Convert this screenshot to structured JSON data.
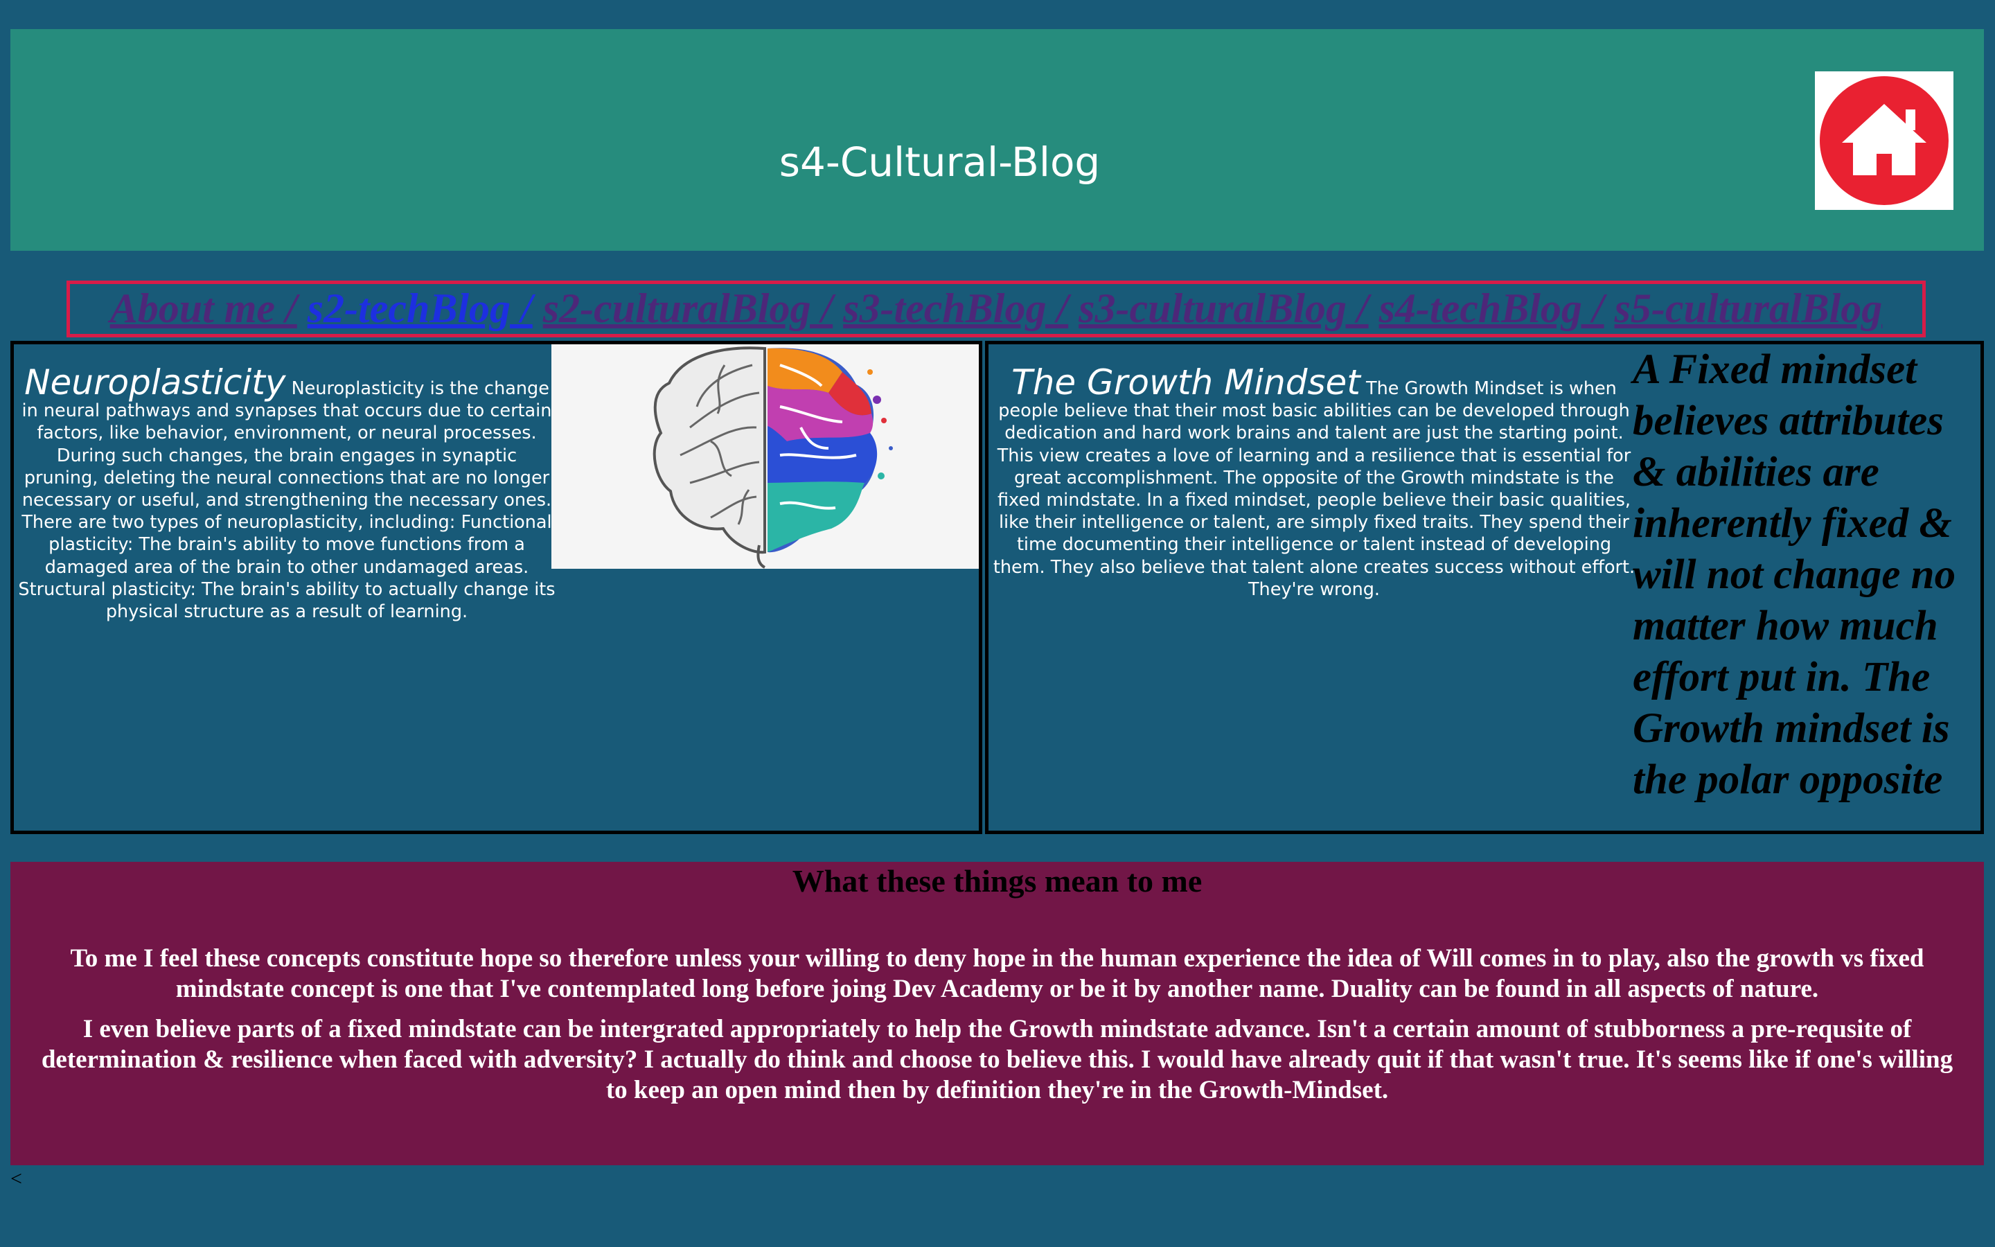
{
  "header": {
    "title": "s4-Cultural-Blog",
    "home_icon": "home-icon",
    "home_icon_color": "#e92131"
  },
  "nav": {
    "items": [
      {
        "label": "About me /"
      },
      {
        "label": "s2-techBlog /"
      },
      {
        "label": "s2-culturalBlog /"
      },
      {
        "label": "s3-techBlog /"
      },
      {
        "label": "s3-culturalBlog /"
      },
      {
        "label": "s4-techBlog /"
      },
      {
        "label": "s5-culturalBlog"
      }
    ],
    "active_color": "#1d2fe0",
    "link_color": "#4d2779",
    "border_color": "#d81c48"
  },
  "neuroplasticity": {
    "title": "Neuroplasticity",
    "body": "Neuroplasticity is the change in neural pathways and synapses that occurs due to certain factors, like behavior, environment, or neural processes. During such changes, the brain engages in synaptic pruning, deleting the neural connections that are no longer necessary or useful, and strengthening the necessary ones. There are two types of neuroplasticity, including: Functional plasticity: The brain's ability to move functions from a damaged area of the brain to other undamaged areas. Structural plasticity: The brain's ability to actually change its physical structure as a result of learning.",
    "image": "brain-illustration"
  },
  "growth_mindset": {
    "title": "The Growth Mindset",
    "body": "The Growth Mindset is when people believe that their most basic abilities can be developed through dedication and hard work brains and talent are just the starting point. This view creates a love of learning and a resilience that is essential for great accomplishment. The opposite of the Growth mindstate is the fixed mindstate. In a fixed mindset, people believe their basic qualities, like their intelligence or talent, are simply fixed traits. They spend their time documenting their intelligence or talent instead of developing them. They also believe that talent alone creates success without effort. They're wrong.",
    "quote": "A Fixed mindset believes attributes & abilities are inherently fixed & will not change no matter how much effort put in. The Growth mindset is the polar opposite"
  },
  "meaning": {
    "title": "What these things mean to me",
    "paragraph1": "To me I feel these concepts constitute hope so therefore unless your willing to deny hope in the human experience the idea of Will comes in to play, also the growth vs fixed mindstate concept is one that I've contemplated long before joing Dev Academy or be it by another name. Duality can be found in all aspects of nature.",
    "paragraph2": "I even believe parts of a fixed mindstate can be intergrated appropriately to help the Growth mindstate advance. Isn't a certain amount of stubborness a pre-requsite of determination & resilience when faced with adversity? I actually do think and choose to believe this. I would have already quit if that wasn't true. It's seems like if one's willing to keep an open mind then by definition they're in the Growth-Mindset."
  },
  "footer": {
    "text": "<"
  },
  "colors": {
    "page_background": "#185a78",
    "header_background": "#268c7d",
    "meaning_background": "#721647"
  }
}
